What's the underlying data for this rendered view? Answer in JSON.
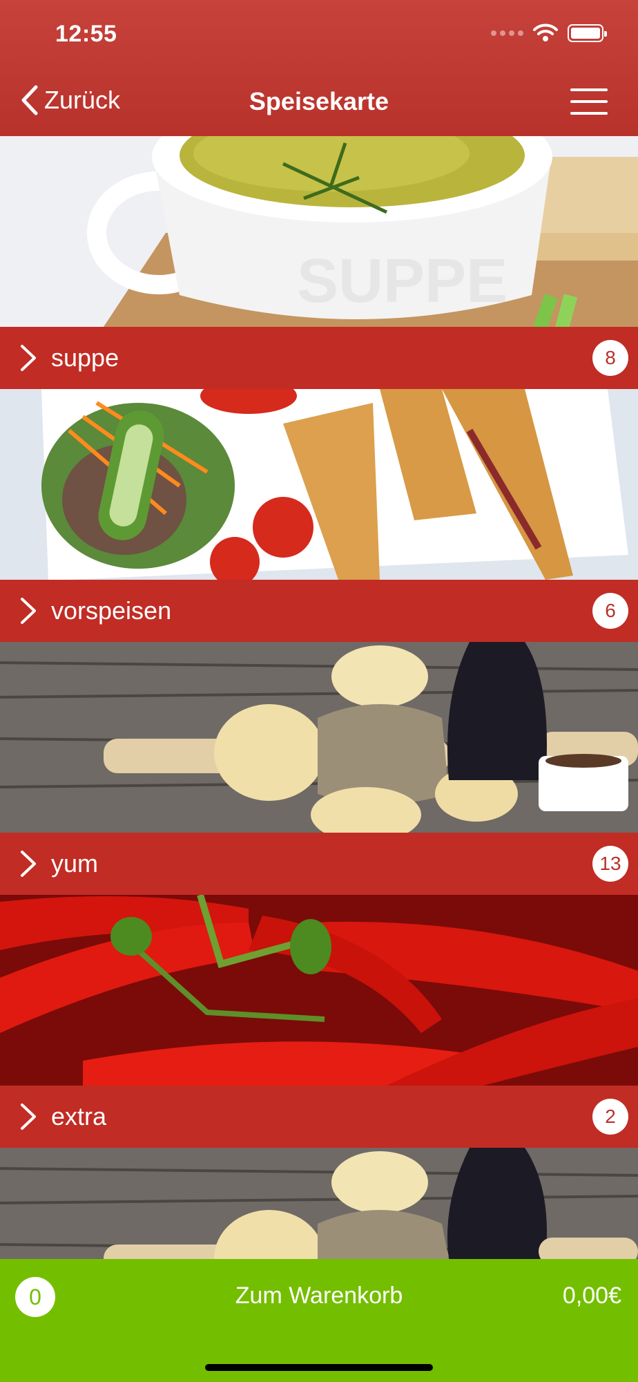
{
  "status_bar": {
    "time": "12:55"
  },
  "nav": {
    "back_label": "Zurück",
    "title": "Speisekarte"
  },
  "categories": [
    {
      "label": "suppe",
      "count": "8"
    },
    {
      "label": "vorspeisen",
      "count": "6"
    },
    {
      "label": "yum",
      "count": "13"
    },
    {
      "label": "extra",
      "count": "2"
    }
  ],
  "cart": {
    "count": "0",
    "label": "Zum Warenkorb",
    "total": "0,00€"
  },
  "colors": {
    "header": "#b8322b",
    "category_bar": "#c12c24",
    "footer": "#74be00"
  },
  "icons": {
    "back": "chevron-left-icon",
    "menu": "hamburger-menu-icon",
    "category": "chevron-right-icon"
  }
}
